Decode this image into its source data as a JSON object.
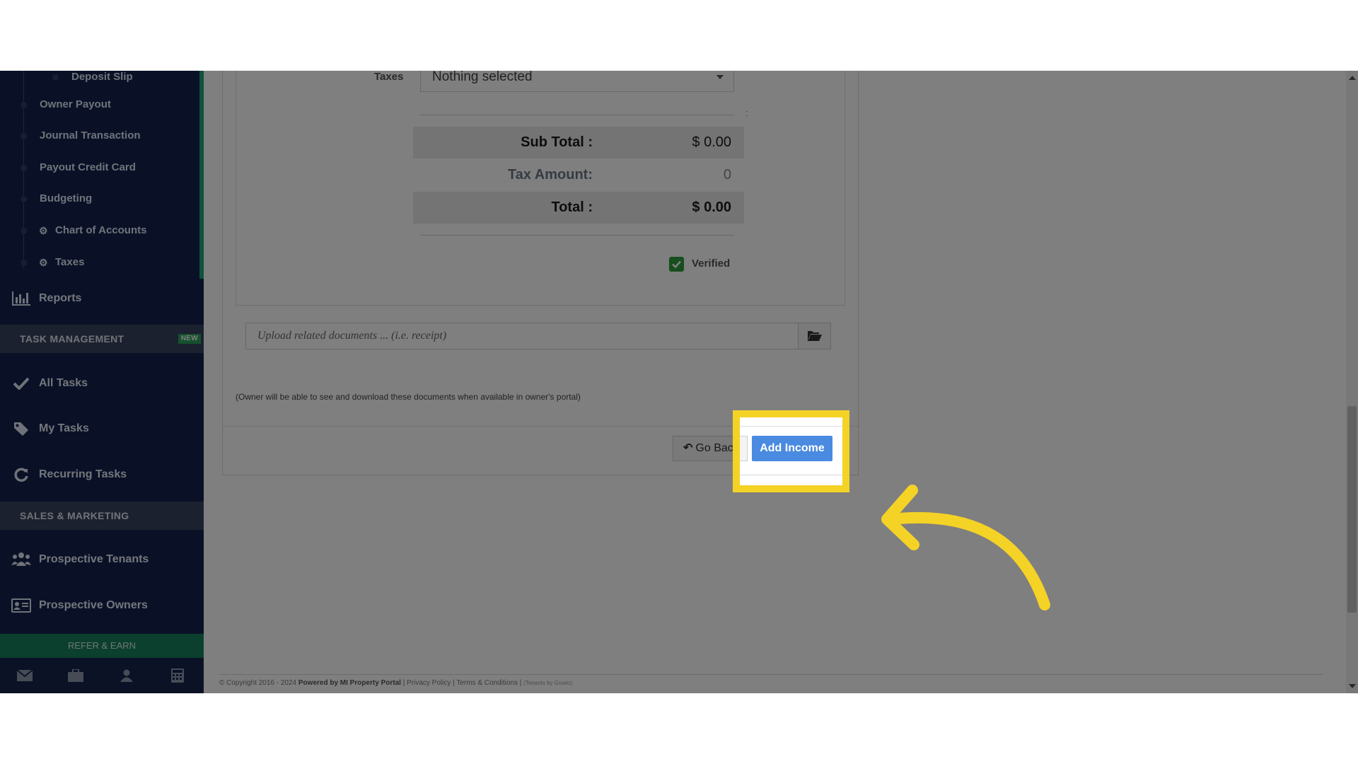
{
  "sidebar": {
    "sub_items": [
      {
        "label": "Deposit Slip"
      },
      {
        "label": "Owner Payout"
      },
      {
        "label": "Journal Transaction"
      },
      {
        "label": "Payout Credit Card"
      },
      {
        "label": "Budgeting"
      },
      {
        "label": "Chart of Accounts",
        "icon": "gear-icon"
      },
      {
        "label": "Taxes",
        "icon": "gear-icon"
      }
    ],
    "reports": {
      "label": "Reports",
      "icon": "bar-chart-icon"
    },
    "task_section": {
      "label": "TASK MANAGEMENT",
      "badge": "NEW"
    },
    "tasks": [
      {
        "label": "All Tasks",
        "icon": "check-icon"
      },
      {
        "label": "My Tasks",
        "icon": "tag-icon"
      },
      {
        "label": "Recurring Tasks",
        "icon": "refresh-icon"
      }
    ],
    "sales_section": {
      "label": "SALES & MARKETING"
    },
    "sales": [
      {
        "label": "Prospective Tenants",
        "icon": "users-icon"
      },
      {
        "label": "Prospective Owners",
        "icon": "id-card-icon"
      }
    ],
    "refer": {
      "label": "REFER & EARN"
    },
    "footer_icons": [
      "envelope-icon",
      "briefcase-icon",
      "user-icon",
      "calculator-icon"
    ]
  },
  "form": {
    "taxes_label": "Taxes",
    "taxes_value": "Nothing selected",
    "colon_mark": ":",
    "sub_total_label": "Sub Total :",
    "sub_total_value": "$ 0.00",
    "tax_amount_label": "Tax Amount:",
    "tax_amount_value": "0",
    "total_label": "Total :",
    "total_value": "$ 0.00",
    "verified_label": "Verified",
    "verified_checked": true,
    "upload_placeholder": "Upload related documents ... (i.e. receipt)",
    "owner_note": "(Owner will be able to see and download these documents when available in owner's portal)",
    "go_back_label": "Go Back",
    "add_income_label": "Add Income"
  },
  "footer": {
    "copyright": "© Copyright 2016 - 2024",
    "powered_by": "Powered by MI Property Portal",
    "privacy": "Privacy Policy",
    "terms": "Terms & Conditions",
    "tiny": "(Tenants by Gowlo)"
  },
  "colors": {
    "highlight": "#f5d226",
    "primary_button": "#4a8ae0",
    "sidebar_bg": "#14234f",
    "refer_bg": "#177f5c"
  }
}
